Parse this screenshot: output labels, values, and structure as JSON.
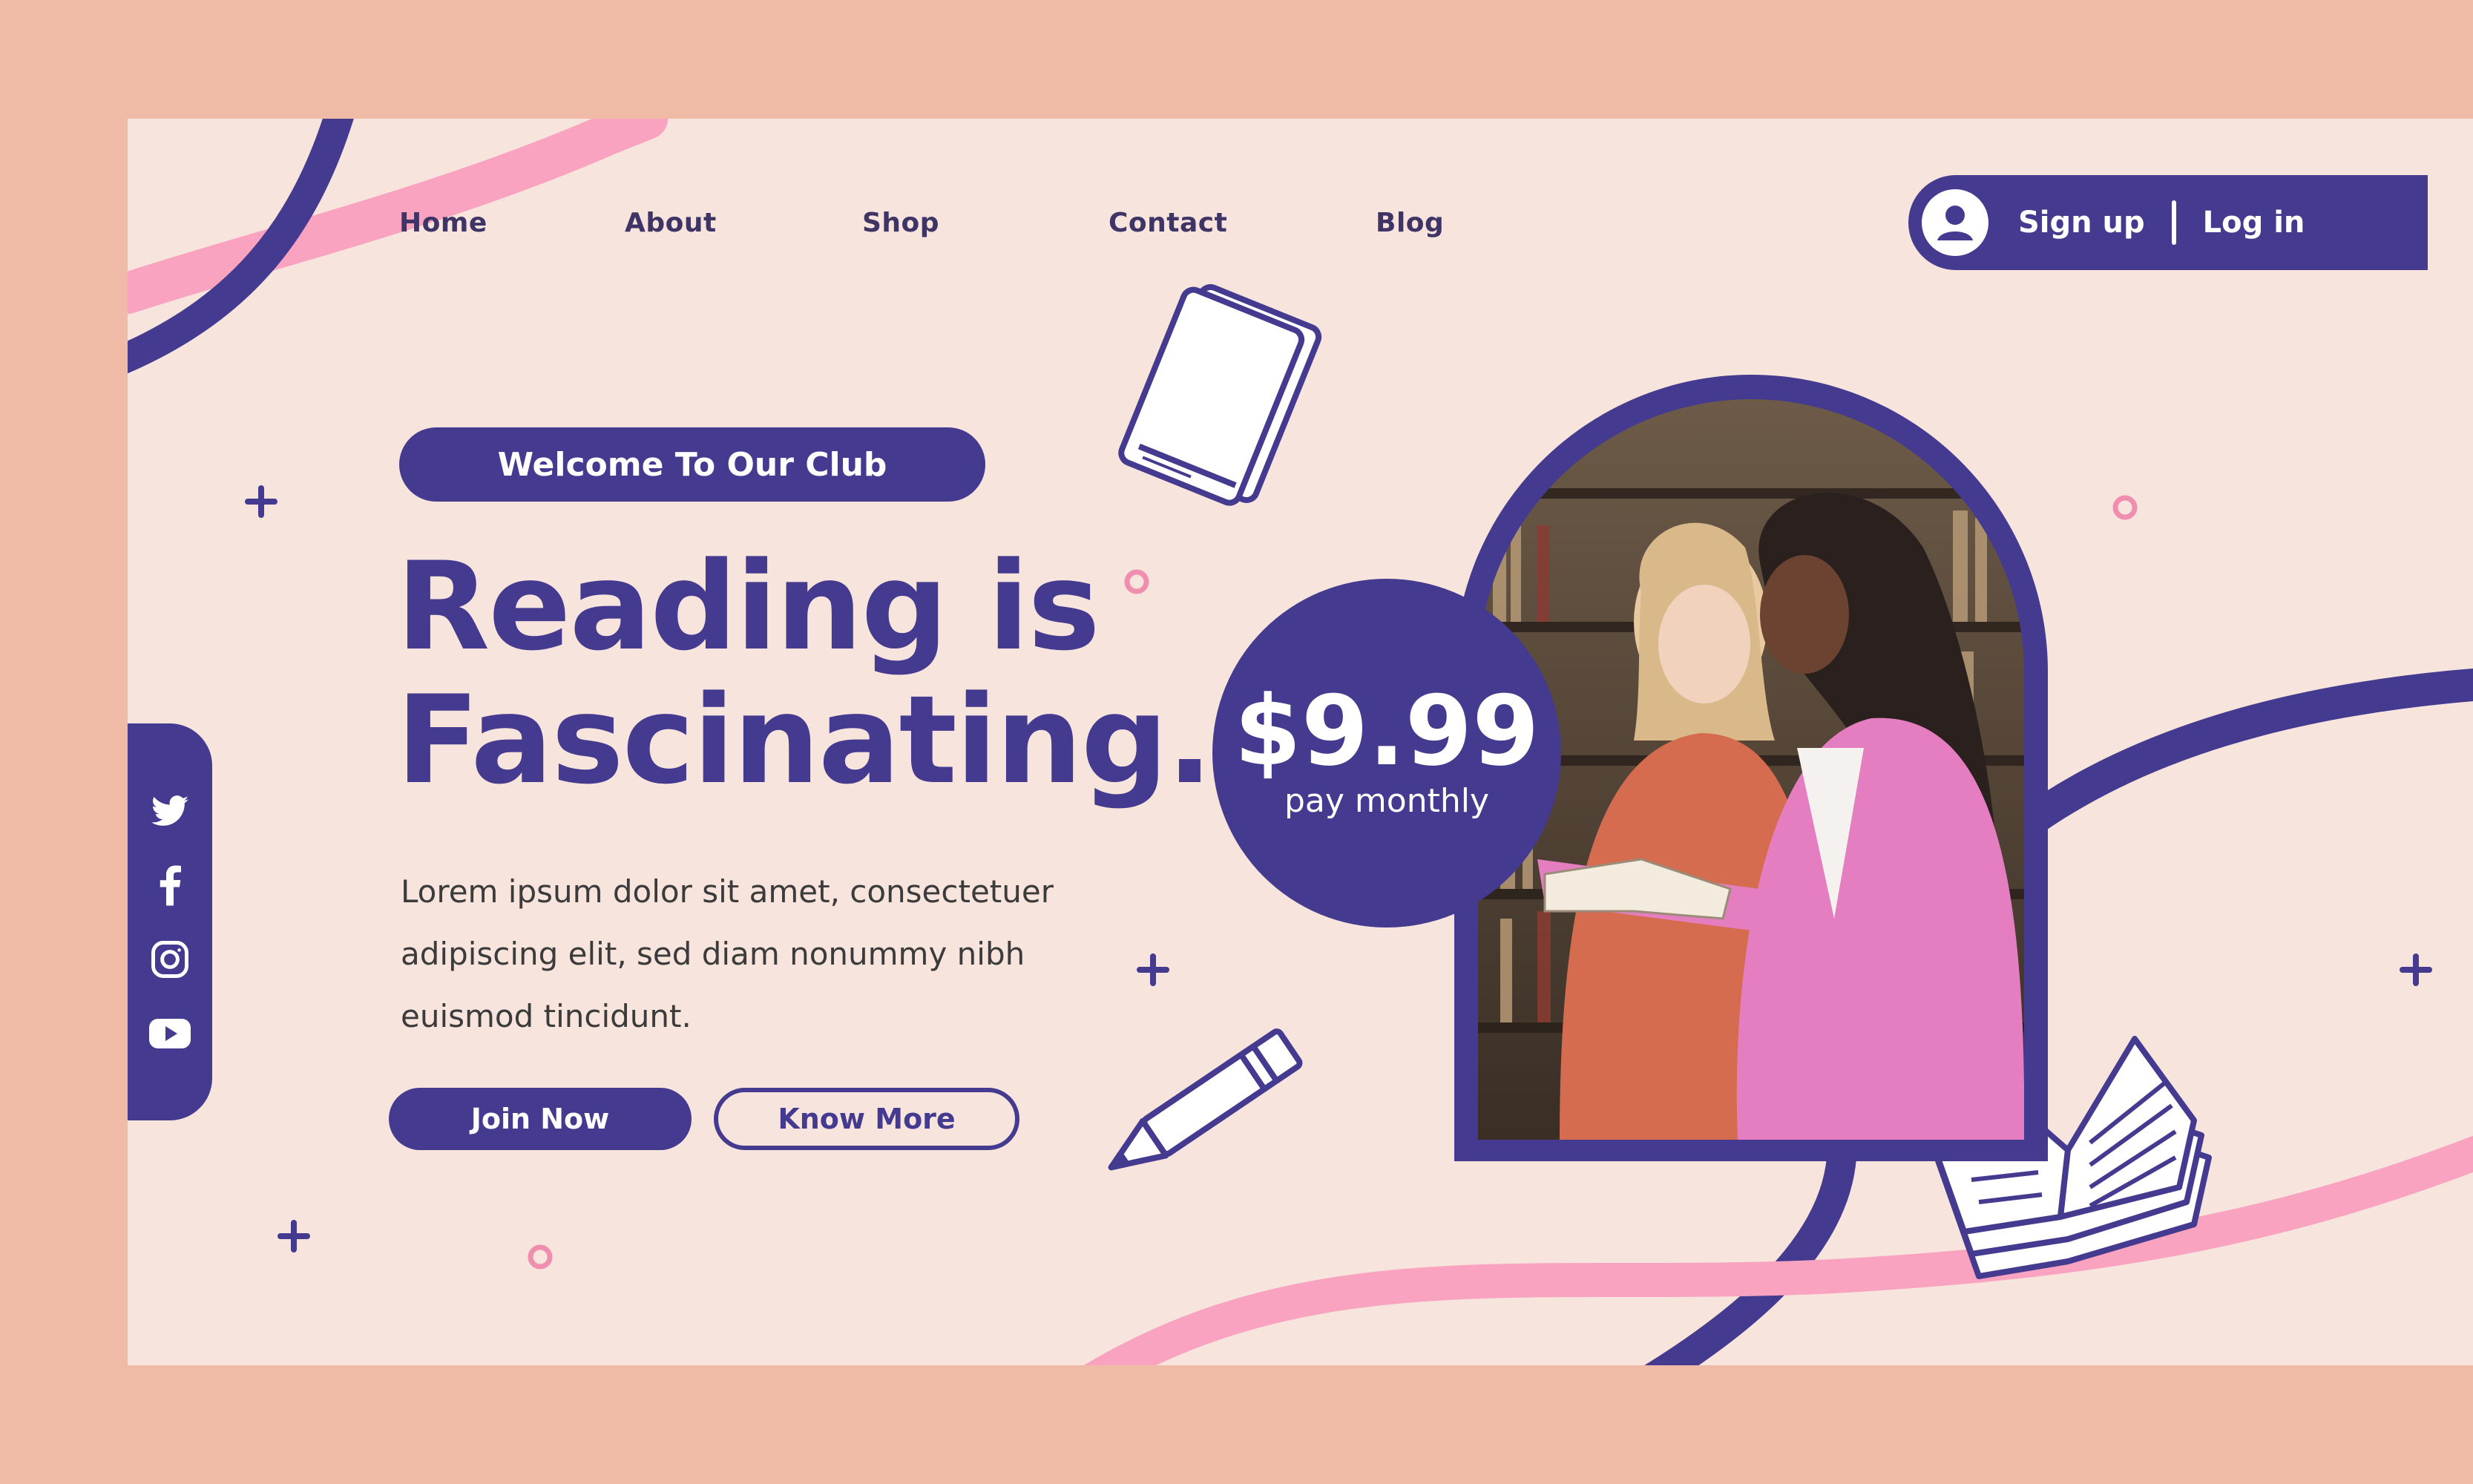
{
  "nav": {
    "items": [
      {
        "label": "Home"
      },
      {
        "label": "About"
      },
      {
        "label": "Shop"
      },
      {
        "label": "Contact"
      },
      {
        "label": "Blog"
      }
    ]
  },
  "auth": {
    "signup_label": "Sign up",
    "login_label": "Log in",
    "icon": "user-icon"
  },
  "hero": {
    "badge": "Welcome To Our Club",
    "headline_line1": "Reading is",
    "headline_line2": "Fascinating.",
    "body": "Lorem ipsum dolor sit amet, consectetuer adipiscing elit, sed diam nonummy nibh euismod tincidunt.",
    "join_label": "Join Now",
    "know_label": "Know More"
  },
  "price": {
    "amount": "$9.99",
    "period": "pay monthly"
  },
  "social": {
    "icons": [
      "twitter-icon",
      "facebook-icon",
      "instagram-icon",
      "youtube-icon"
    ]
  },
  "colors": {
    "primary": "#443a8f",
    "background": "#f7e4dc",
    "outer": "#efbba6",
    "accent_pink": "#f9a3c0",
    "text": "#3b3b3b"
  }
}
